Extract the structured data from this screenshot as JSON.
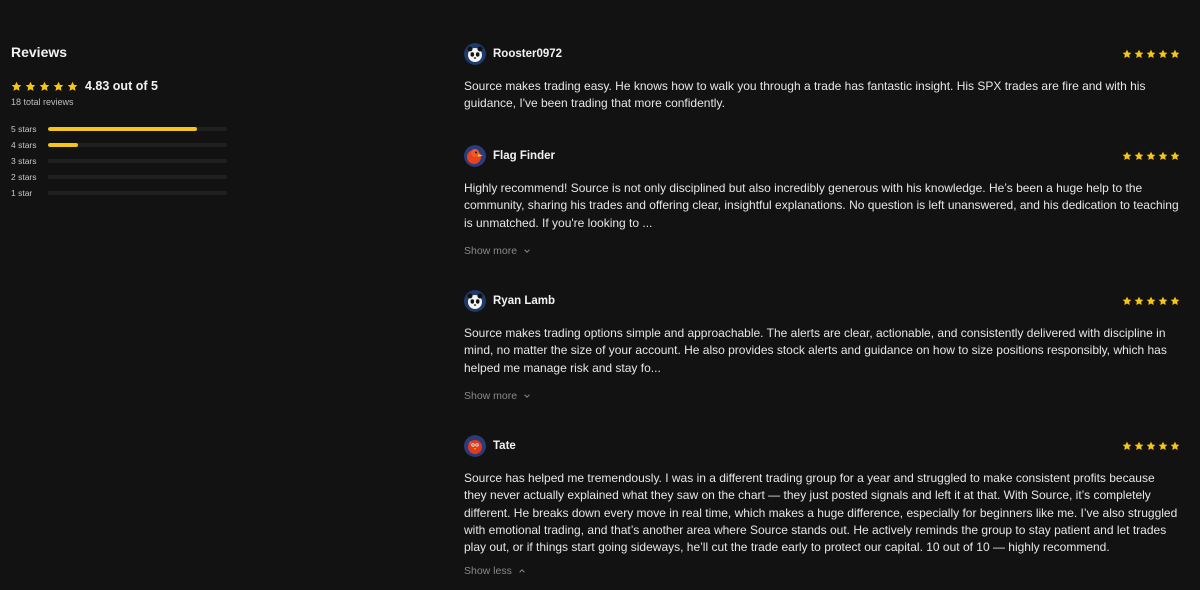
{
  "summary": {
    "title": "Reviews",
    "rating_text": "4.83 out of 5",
    "rating_value": 4.83,
    "total_reviews": "18 total reviews",
    "breakdown": [
      {
        "label": "5 stars",
        "fraction": 0.83
      },
      {
        "label": "4 stars",
        "fraction": 0.17
      },
      {
        "label": "3 stars",
        "fraction": 0
      },
      {
        "label": "2 stars",
        "fraction": 0
      },
      {
        "label": "1 star",
        "fraction": 0
      }
    ]
  },
  "colors": {
    "star": "#f5c518",
    "bar_fill": "#f5c518",
    "background": "#121212"
  },
  "reviews": [
    {
      "author": "Rooster0972",
      "avatar_icon": "panda-avatar-icon",
      "stars": 5,
      "text": "Source makes trading easy. He knows how to walk you through a trade has fantastic insight. His SPX trades are fire and with his guidance, I've been trading that more confidently.",
      "toggle": ""
    },
    {
      "author": "Flag Finder",
      "avatar_icon": "duck-avatar-icon",
      "stars": 5,
      "text": "Highly recommend! Source is not only disciplined but also incredibly generous with his knowledge. He’s been a huge help to the community, sharing his trades and offering clear, insightful explanations. No question is left unanswered, and his dedication to teaching is unmatched. If you're looking to ...",
      "toggle": "Show more"
    },
    {
      "author": "Ryan Lamb",
      "avatar_icon": "panda-avatar-icon",
      "stars": 5,
      "text": "Source makes trading options simple and approachable. The alerts are clear, actionable, and consistently delivered with discipline in mind, no matter the size of your account. He also provides stock alerts and guidance on how to size positions responsibly, which has helped me manage risk and stay fo...",
      "toggle": "Show more"
    },
    {
      "author": "Tate",
      "avatar_icon": "bird-avatar-icon",
      "stars": 5,
      "text": "Source has helped me tremendously. I was in a different trading group for a year and struggled to make consistent profits because they never actually explained what they saw on the chart — they just posted signals and left it at that. With Source, it’s completely different. He breaks down every move in real time, which makes a huge difference, especially for beginners like me. I’ve also struggled with emotional trading, and that’s another area where Source stands out. He actively reminds the group to stay patient and let trades play out, or if things start going sideways, he’ll cut the trade early to protect our capital. 10 out of 10 — highly recommend.",
      "toggle": "Show less"
    }
  ]
}
